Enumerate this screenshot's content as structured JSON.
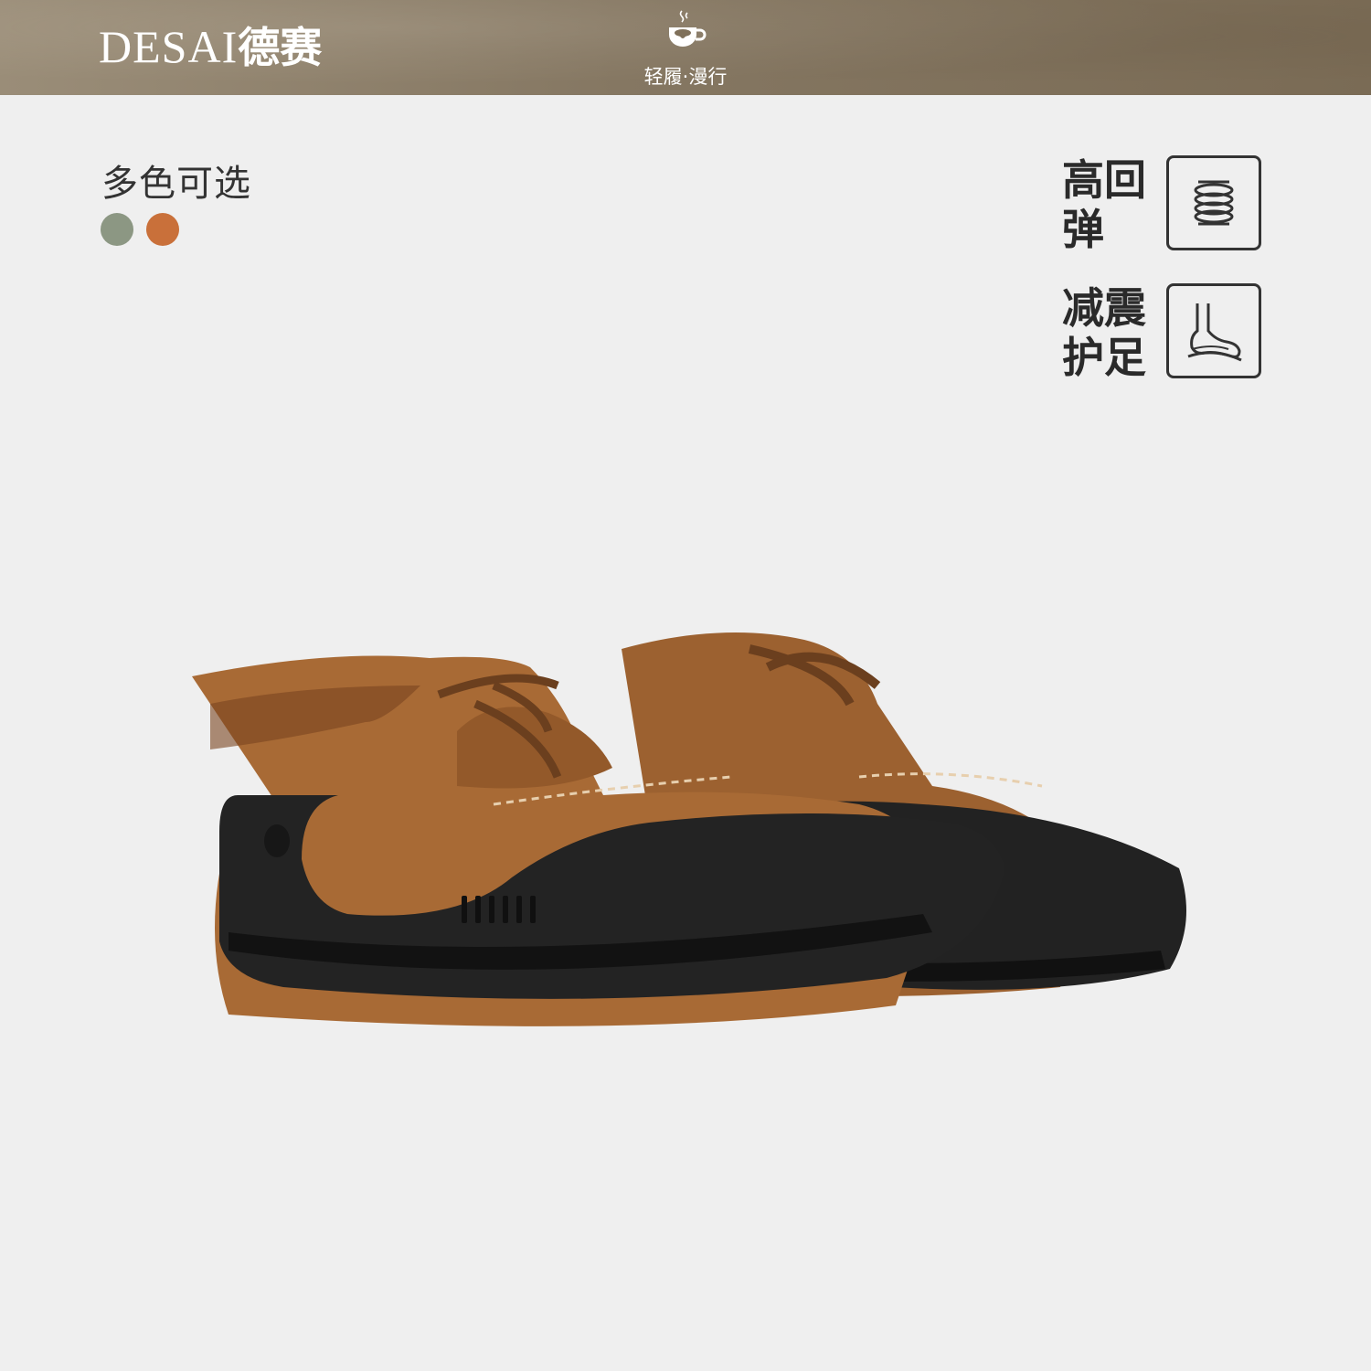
{
  "header": {
    "brand_latin": "DESAI",
    "brand_chinese": "德赛",
    "slogan": "轻履·漫行",
    "slogan_icon": "coffee-cup-icon"
  },
  "colors_section": {
    "title": "多色可选",
    "swatches": [
      {
        "name": "sage-green",
        "color": "#8c9783"
      },
      {
        "name": "caramel-brown",
        "color": "#c9703a"
      }
    ]
  },
  "features": [
    {
      "lines": [
        "高回",
        "弹"
      ],
      "icon": "spring-icon"
    },
    {
      "lines": [
        "减震",
        "护足"
      ],
      "icon": "foot-cushion-icon"
    }
  ],
  "product": {
    "image": "brown-suede-lace-up-shoes-pair",
    "upper_color": "#a86a35",
    "sole_color": "#1f1f1f"
  }
}
